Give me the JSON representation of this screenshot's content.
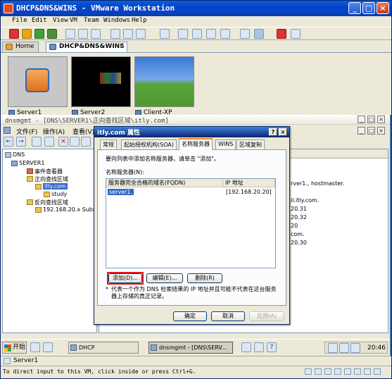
{
  "window": {
    "title": "DHCP&DNS&WINS - VMware Workstation",
    "min": "_",
    "max": "□",
    "close": "×"
  },
  "menu": {
    "file": "File",
    "edit": "Edit",
    "view": "View",
    "vm": "VM",
    "team": "Team",
    "windows": "Windows",
    "help": "Help"
  },
  "tabs": {
    "home": "Home",
    "vm": "DHCP&DNS&WINS"
  },
  "thumbnails": [
    {
      "label": "Server1"
    },
    {
      "label": "Server2"
    },
    {
      "label": "Client-XP"
    }
  ],
  "mmc": {
    "title": "dnsmgmt - [DNS\\SERVER1\\正向查找区域\\itly.com]",
    "menu": {
      "file": "文件(F)",
      "action": "操作(A)",
      "view": "查看(V)"
    },
    "tree": {
      "dns": "DNS",
      "server": "SERVER1",
      "event_viewer": "事件查看器",
      "forward_zones": "正向查找区域",
      "zone": "itly.com",
      "study": "study",
      "reverse_zones": "反向查找区域",
      "reverse_subnet": "192.168.20.x Subne"
    },
    "details_fragments": [
      "rver1., hostmaster.",
      "il.itly.com.",
      "20.31",
      "20.32",
      "20",
      "com.",
      "20.30"
    ]
  },
  "dialog": {
    "title": "itly.com 属性",
    "help": "?",
    "close": "×",
    "tabs": [
      "常规",
      "起始授权机构(SOA)",
      "名称服务器",
      "WINS",
      "区域复制"
    ],
    "instruction": "要向列表中添加名称服务器，请单击 \"添加\"。",
    "list_label": "名称服务器(N):",
    "columns": {
      "fqdn": "服务器完全合格的域名(FQDN)",
      "ip": "IP 地址"
    },
    "rows": [
      {
        "fqdn": "server1.",
        "ip": "[192.168.20.20]"
      }
    ],
    "add": "添加(D)...",
    "edit": "编辑(E)...",
    "remove": "删除(R)",
    "note_star": "*",
    "note": "代表一个作为 DNS 检索结果的 IP 地址并且可能不代表在这台服务器上存储的真正记录。",
    "ok": "确定",
    "cancel": "取消",
    "apply": "应用(A)"
  },
  "guest_taskbar": {
    "start": "开始",
    "items": [
      "DHCP",
      "dnsmgmt - [DNS\\SERV..."
    ],
    "clock": "20:46"
  },
  "statusbar": {
    "vm": "Server1",
    "tip": "To direct input to this VM, click inside or press Ctrl+G."
  }
}
